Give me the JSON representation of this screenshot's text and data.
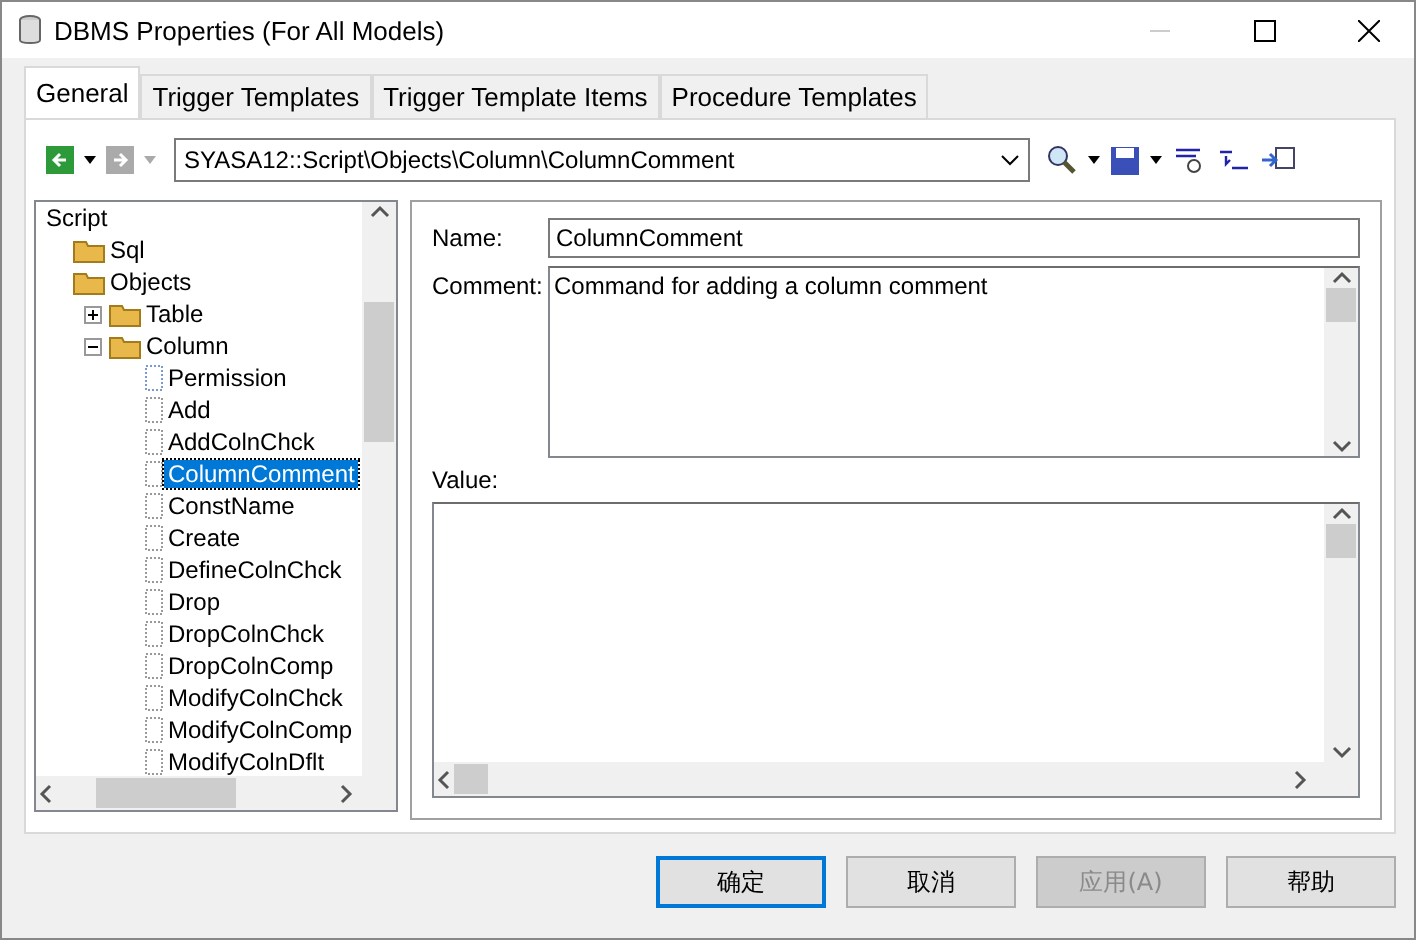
{
  "window": {
    "title": "DBMS Properties (For All Models)"
  },
  "tabs": [
    {
      "label": "General",
      "selected": true
    },
    {
      "label": "Trigger Templates",
      "selected": false
    },
    {
      "label": "Trigger Template Items",
      "selected": false
    },
    {
      "label": "Procedure Templates",
      "selected": false
    }
  ],
  "toolbar": {
    "back_disabled": false,
    "forward_disabled": true,
    "path": "SYASA12::Script\\Objects\\Column\\ColumnComment"
  },
  "tree": {
    "root": "Script",
    "items": [
      {
        "label": "Sql",
        "kind": "folder",
        "selected": false
      },
      {
        "label": "Objects",
        "kind": "folder",
        "selected": false,
        "children": [
          {
            "label": "Table",
            "kind": "folder",
            "expanded": false,
            "selected": false
          },
          {
            "label": "Column",
            "kind": "folder",
            "expanded": true,
            "selected": false,
            "children": [
              {
                "label": "Permission",
                "kind": "special",
                "selected": false
              },
              {
                "label": "Add",
                "kind": "item",
                "selected": false
              },
              {
                "label": "AddColnChck",
                "kind": "item",
                "selected": false
              },
              {
                "label": "ColumnComment",
                "kind": "item",
                "selected": true
              },
              {
                "label": "ConstName",
                "kind": "item",
                "selected": false
              },
              {
                "label": "Create",
                "kind": "item",
                "selected": false
              },
              {
                "label": "DefineColnChck",
                "kind": "item",
                "selected": false
              },
              {
                "label": "Drop",
                "kind": "item",
                "selected": false
              },
              {
                "label": "DropColnChck",
                "kind": "item",
                "selected": false
              },
              {
                "label": "DropColnComp",
                "kind": "item",
                "selected": false
              },
              {
                "label": "ModifyColnChck",
                "kind": "item",
                "selected": false
              },
              {
                "label": "ModifyColnComp",
                "kind": "item",
                "selected": false
              },
              {
                "label": "ModifyColnDflt",
                "kind": "item",
                "selected": false
              }
            ]
          }
        ]
      }
    ]
  },
  "form": {
    "name_label": "Name:",
    "name_value": "ColumnComment",
    "comment_label": "Comment:",
    "comment_value": "Command for adding a column comment",
    "value_label": "Value:"
  },
  "buttons": [
    {
      "label": "确定",
      "default": true,
      "disabled": false
    },
    {
      "label": "取消",
      "default": false,
      "disabled": false
    },
    {
      "label": "应用(A)",
      "default": false,
      "disabled": true
    },
    {
      "label": "帮助",
      "default": false,
      "disabled": false
    }
  ]
}
